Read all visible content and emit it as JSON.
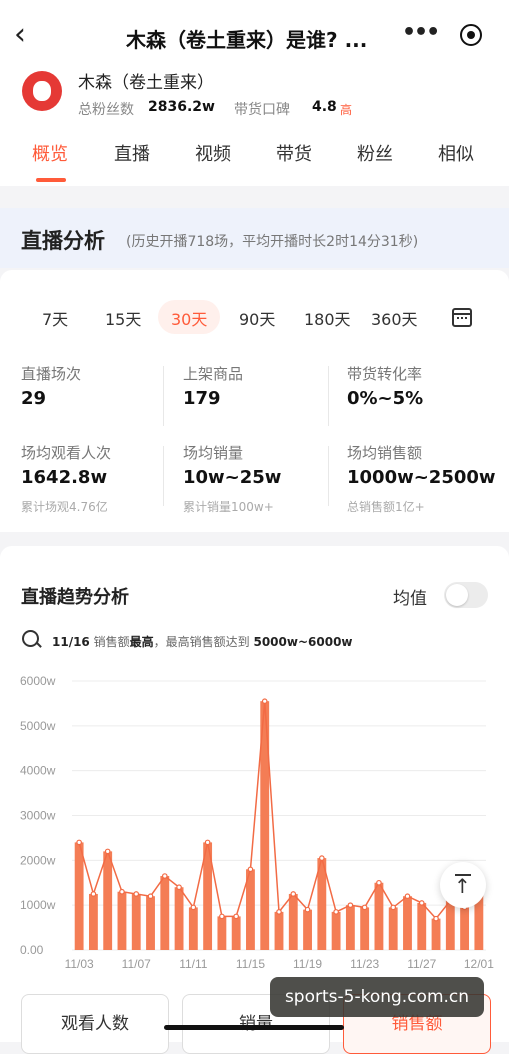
{
  "header": {
    "title": "木森（卷土重来）是谁? ...",
    "more": "•••"
  },
  "profile": {
    "name": "木森（卷土重来）",
    "fans_label": "总粉丝数",
    "fans_value": "2836.2w",
    "reputation_label": "带货口碑",
    "reputation_value": "4.8",
    "reputation_level": "高"
  },
  "tabs": [
    "概览",
    "直播",
    "视频",
    "带货",
    "粉丝",
    "相似"
  ],
  "active_tab": "概览",
  "live": {
    "title": "直播分析",
    "subtitle": "(历史开播718场，平均开播时长2时14分31秒)"
  },
  "ranges": [
    "7天",
    "15天",
    "30天",
    "90天",
    "180天",
    "360天"
  ],
  "active_range": "30天",
  "metrics": [
    {
      "label": "直播场次",
      "value": "29",
      "sub": ""
    },
    {
      "label": "上架商品",
      "value": "179",
      "sub": ""
    },
    {
      "label": "带货转化率",
      "value": "0%~5%",
      "sub": ""
    },
    {
      "label": "场均观看人次",
      "value": "1642.8w",
      "sub": "累计场观4.76亿"
    },
    {
      "label": "场均销量",
      "value": "10w~25w",
      "sub": "累计销量100w+"
    },
    {
      "label": "场均销售额",
      "value": "1000w~2500w",
      "sub": "总销售额1亿+"
    }
  ],
  "trend": {
    "title": "直播趋势分析",
    "avg_label": "均值",
    "note_date": "11/16",
    "note_p1": "销售额",
    "note_bold": "最高",
    "note_p2": "，最高销售额达到",
    "note_range": "5000w~6000w"
  },
  "bottom_tabs": [
    "观看人数",
    "销量",
    "销售额"
  ],
  "active_bottom_tab": "销售额",
  "watermark": "sports-5-kong.com.cn",
  "colors": {
    "accent": "#ff5b3a",
    "bar": "#f47d55",
    "line": "#f26b45"
  },
  "chart_data": {
    "type": "bar",
    "ylim": [
      0,
      6000
    ],
    "y_ticks": [
      "0.00",
      "1000w",
      "2000w",
      "3000w",
      "4000w",
      "5000w",
      "6000w"
    ],
    "x_tick_labels": [
      "11/03",
      "11/07",
      "11/11",
      "11/15",
      "11/19",
      "11/23",
      "11/27",
      "12/01"
    ],
    "series": [
      {
        "values": [
          2400,
          1250,
          2200,
          1300,
          1250,
          1200,
          1650,
          1400,
          950,
          2400,
          750,
          750,
          1800,
          5550,
          850,
          1250,
          900,
          2050,
          850,
          1000,
          950,
          1500,
          950,
          1200,
          1050,
          700,
          1100,
          950,
          1350
        ]
      }
    ]
  }
}
